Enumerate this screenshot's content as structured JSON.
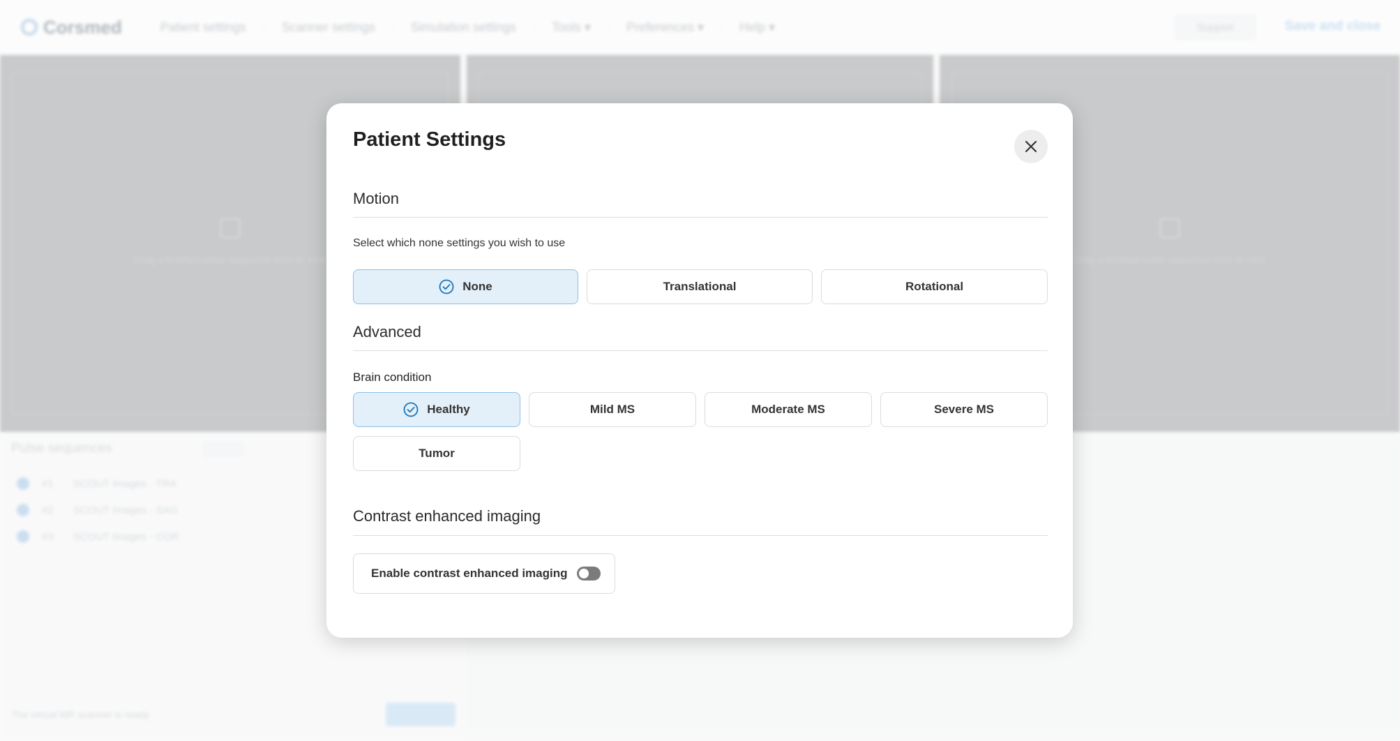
{
  "app": {
    "logo_text": "Corsmed",
    "nav": [
      {
        "label": "Patient settings"
      },
      {
        "label": "Scanner settings"
      },
      {
        "label": "Simulation settings"
      },
      {
        "label": "Tools ▾"
      },
      {
        "label": "Preferences ▾"
      },
      {
        "label": "Help ▾"
      }
    ],
    "support_label": "Support",
    "save_close_label": "Save and close",
    "viewport_hint": "Drag a finished pulse sequence here to view",
    "pulse_sequences": {
      "title": "Pulse sequences",
      "items": [
        {
          "num": "#1",
          "label": "SCOUT Images - TRA"
        },
        {
          "num": "#2",
          "label": "SCOUT Images - SAG"
        },
        {
          "num": "#3",
          "label": "SCOUT Images - COR"
        }
      ]
    },
    "status_text": "The virtual MR scanner is ready"
  },
  "modal": {
    "title": "Patient Settings",
    "motion": {
      "title": "Motion",
      "description": "Select which none settings you wish to use",
      "options": [
        {
          "label": "None",
          "selected": true
        },
        {
          "label": "Translational",
          "selected": false
        },
        {
          "label": "Rotational",
          "selected": false
        }
      ]
    },
    "advanced": {
      "title": "Advanced",
      "brain_condition_label": "Brain condition",
      "options": [
        {
          "label": "Healthy",
          "selected": true
        },
        {
          "label": "Mild MS",
          "selected": false
        },
        {
          "label": "Moderate MS",
          "selected": false
        },
        {
          "label": "Severe MS",
          "selected": false
        },
        {
          "label": "Tumor",
          "selected": false
        }
      ]
    },
    "contrast": {
      "title": "Contrast enhanced imaging",
      "toggle_label": "Enable contrast enhanced imaging",
      "enabled": false
    }
  },
  "colors": {
    "accent": "#1a74b8",
    "selected_bg": "#e3f0fa",
    "selected_border": "#8ebee5"
  }
}
